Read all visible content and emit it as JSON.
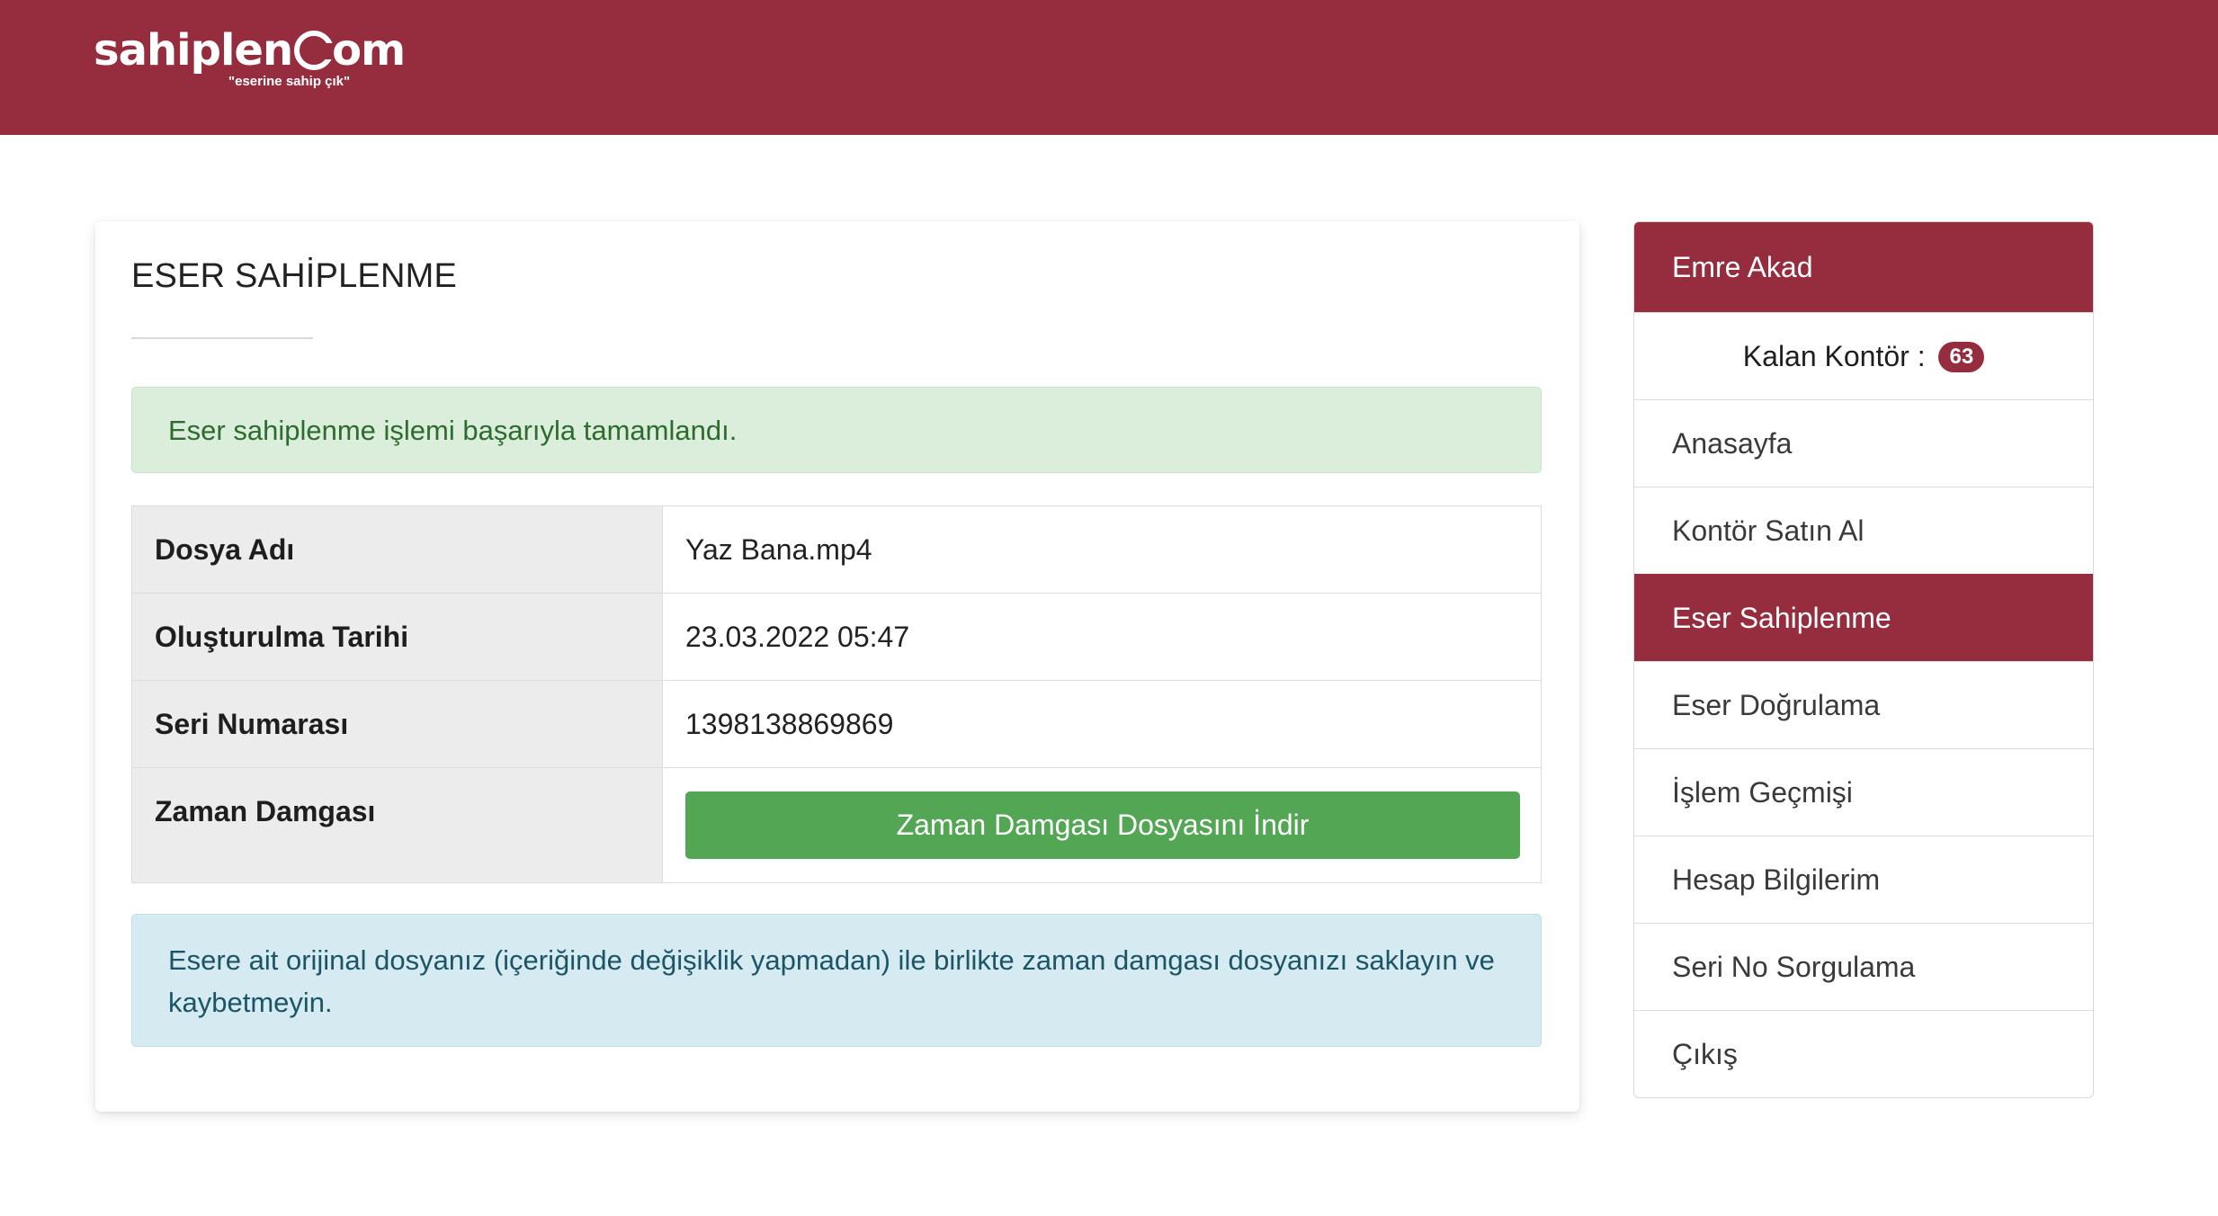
{
  "brand": {
    "logo_word_before": "sahiplen",
    "logo_word_after": "om",
    "tagline": "\"eserine sahip çık\""
  },
  "main": {
    "title": "ESER SAHİPLENME",
    "success_message": "Eser sahiplenme işlemi başarıyla tamamlandı.",
    "table": [
      {
        "label": "Dosya Adı",
        "value": "Yaz Bana.mp4"
      },
      {
        "label": "Oluşturulma Tarihi",
        "value": "23.03.2022 05:47"
      },
      {
        "label": "Seri Numarası",
        "value": "1398138869869"
      },
      {
        "label": "Zaman Damgası",
        "button_label": "Zaman Damgası Dosyasını İndir"
      }
    ],
    "info_message": "Esere ait orijinal dosyanız (içeriğinde değişiklik yapmadan) ile birlikte zaman damgası dosyanızı saklayın ve kaybetmeyin."
  },
  "sidebar": {
    "user_name": "Emre Akad",
    "credits_label": "Kalan Kontör :",
    "credits_value": "63",
    "items": [
      {
        "label": "Anasayfa"
      },
      {
        "label": "Kontör Satın Al"
      },
      {
        "label": "Eser Sahiplenme",
        "active": true
      },
      {
        "label": "Eser Doğrulama"
      },
      {
        "label": "İşlem Geçmişi"
      },
      {
        "label": "Hesap Bilgilerim"
      },
      {
        "label": "Seri No Sorgulama"
      },
      {
        "label": "Çıkış"
      }
    ]
  },
  "colors": {
    "brand": "#952d3e",
    "success_bg": "#dbeedb",
    "info_bg": "#d6ebf1",
    "button_green": "#53a653"
  }
}
